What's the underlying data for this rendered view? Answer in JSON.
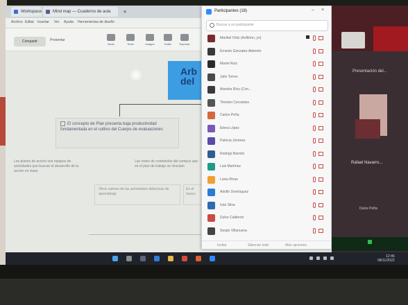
{
  "browser": {
    "tabs": [
      {
        "label": "Workspace Home"
      },
      {
        "label": "Mind map — Cuaderno de aula"
      }
    ]
  },
  "menu": [
    "Archivo",
    "Editar",
    "Insertar",
    "Ver",
    "Ayuda",
    "Herramientas de diseño"
  ],
  "toolbar": {
    "share_label": "Compartir",
    "present_label": "Presentar",
    "tools": [
      "Nodo",
      "Texto",
      "Imagen",
      "Estilo",
      "Exportar",
      "Ajustes"
    ]
  },
  "mindmap": {
    "blue_node_text": "Arb del",
    "main_node_text": "El concepto de Plan presenta baja productividad fundamentada en el cultivo del Cuerpo de evaluaciones",
    "left_text": "Los planes de acción son equipos de actividades que buscan el desarrollo de la acción en clase.",
    "mid_text": "Las redes de contenidos del campus que en el plan de trabajo se vinculan",
    "lower_box_text": "Otros valores de las actividades didácticas de aprendizaje",
    "lower_box_2_text": "En el marco"
  },
  "participants_panel": {
    "title": "Participantes (18)",
    "search_placeholder": "Buscar a un participante",
    "rows": [
      {
        "name": "Maribel Ortiz (Anfitrión, yo)",
        "avatar_color": "#7a2a2a"
      },
      {
        "name": "Ernesto Gonzalez Alderete",
        "avatar_color": "#3a3a3a"
      },
      {
        "name": "Mariel Ruiz",
        "avatar_color": "#2a2a2a"
      },
      {
        "name": "Julio Torres",
        "avatar_color": "#4a4a4a"
      },
      {
        "name": "Alondra Ríos (Con...",
        "avatar_color": "#3a3a3a"
      },
      {
        "name": "Timoteo Cervantes",
        "avatar_color": "#555555"
      },
      {
        "name": "Carlos Peña",
        "avatar_color": "#d2693e"
      },
      {
        "name": "Elena López",
        "avatar_color": "#7b58b8"
      },
      {
        "name": "Patricia Jiménez",
        "avatar_color": "#5b4aa8"
      },
      {
        "name": "Rodrigo Barreto",
        "avatar_color": "#2f5f8f"
      },
      {
        "name": "Luis Martínez",
        "avatar_color": "#1f9a8a"
      },
      {
        "name": "Luisa Rivas",
        "avatar_color": "#f0a030"
      },
      {
        "name": "Adolfo Domínguez",
        "avatar_color": "#2e7bd2"
      },
      {
        "name": "Iván Silva",
        "avatar_color": "#2e6bb2"
      },
      {
        "name": "Dulce Calderón",
        "avatar_color": "#c94b42"
      },
      {
        "name": "Sergio Villanueva",
        "avatar_color": "#444444"
      }
    ],
    "footer": {
      "invite_label": "Invitar",
      "mute_all_label": "Silenciar todo",
      "more_label": "Más opciones"
    }
  },
  "video_area": {
    "tile_1_label": "Presentación del...",
    "tile_2_label": "Rafael Navarro...",
    "tile_3_label": "Dulce Peña"
  },
  "taskbar": {
    "clock_time": "12:46",
    "clock_date": "08/11/2022"
  }
}
